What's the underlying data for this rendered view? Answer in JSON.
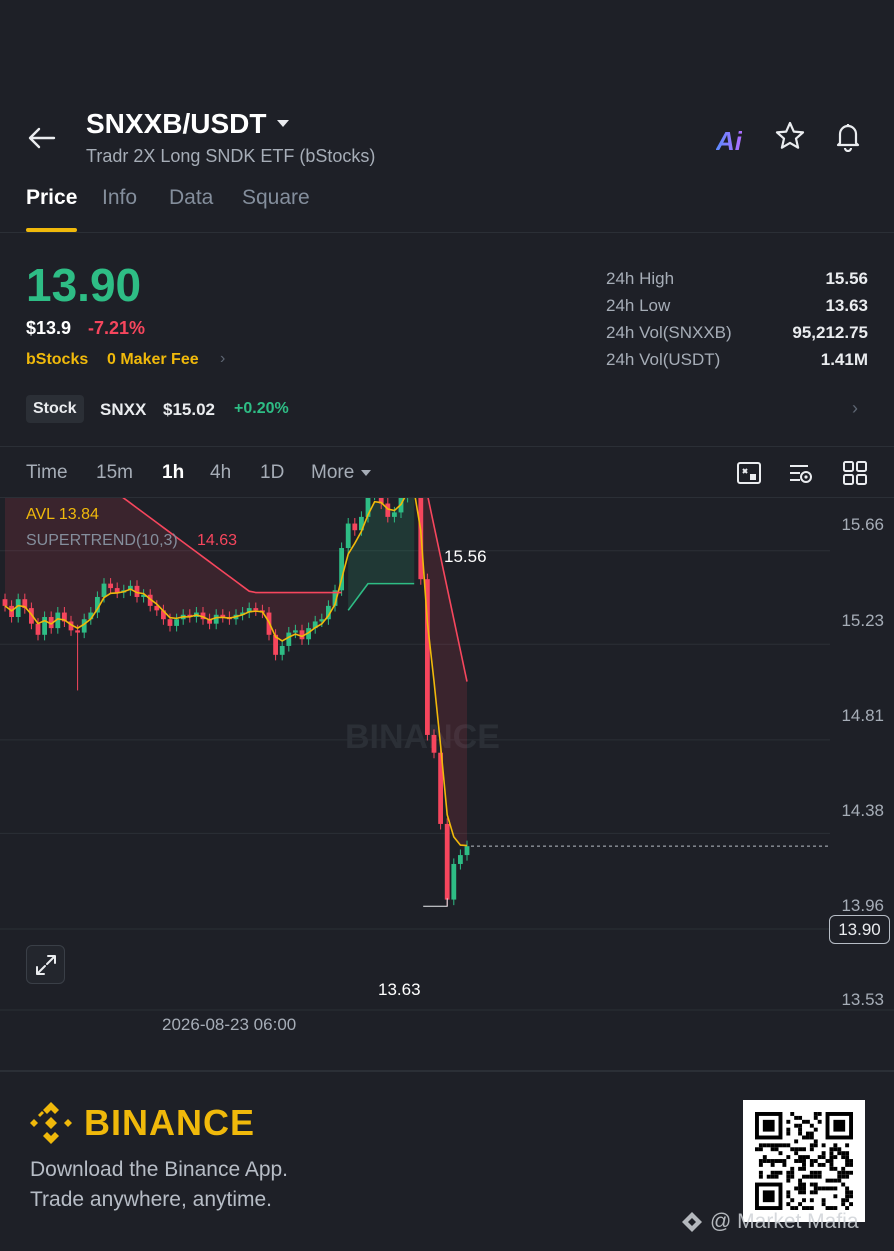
{
  "header": {
    "pair": "SNXXB/USDT",
    "subtitle": "Tradr 2X Long SNDK ETF (bStocks)",
    "ai_label": "Ai"
  },
  "tabs": [
    {
      "label": "Price",
      "active": true
    },
    {
      "label": "Info",
      "active": false
    },
    {
      "label": "Data",
      "active": false
    },
    {
      "label": "Square",
      "active": false
    }
  ],
  "price": {
    "last": "13.90",
    "usd": "$13.9",
    "change_pct": "-7.21%",
    "tag_exchange": "bStocks",
    "tag_fee": "0 Maker Fee"
  },
  "stats": [
    {
      "label": "24h High",
      "value": "15.56"
    },
    {
      "label": "24h Low",
      "value": "13.63"
    },
    {
      "label": "24h Vol(SNXXB)",
      "value": "95,212.75"
    },
    {
      "label": "24h Vol(USDT)",
      "value": "1.41M"
    }
  ],
  "stock": {
    "badge": "Stock",
    "symbol": "SNXX",
    "price": "$15.02",
    "change": "+0.20%"
  },
  "intervals": [
    {
      "label": "Time",
      "active": false
    },
    {
      "label": "15m",
      "active": false
    },
    {
      "label": "1h",
      "active": true
    },
    {
      "label": "4h",
      "active": false
    },
    {
      "label": "1D",
      "active": false
    },
    {
      "label": "More",
      "active": false
    }
  ],
  "indicators": {
    "avl": "AVL 13.84",
    "supertrend_label": "SUPERTREND(10,3)",
    "supertrend_value": "14.63"
  },
  "chart_data": {
    "type": "candlestick",
    "y_ticks": [
      "15.66",
      "15.23",
      "14.81",
      "14.38",
      "13.96",
      "13.53"
    ],
    "ylim": [
      13.4,
      15.75
    ],
    "current_price": "13.90",
    "high_marker": "15.56",
    "low_marker": "13.63",
    "x_label": "2026-08-23 06:00",
    "watermark": "BINANCE",
    "colors": {
      "up": "#2ebd85",
      "down": "#f6465d",
      "avl": "#f0b90b",
      "supertrend": "#f6465d"
    },
    "closes": [
      14.98,
      14.93,
      15.01,
      14.97,
      14.9,
      14.85,
      14.93,
      14.88,
      14.95,
      14.91,
      14.87,
      14.86,
      14.92,
      14.95,
      15.02,
      15.08,
      15.06,
      15.04,
      15.05,
      15.07,
      15.02,
      15.03,
      14.98,
      14.96,
      14.92,
      14.89,
      14.92,
      14.94,
      14.93,
      14.95,
      14.92,
      14.9,
      14.94,
      14.93,
      14.92,
      14.94,
      14.95,
      14.97,
      14.96,
      14.95,
      14.85,
      14.76,
      14.8,
      14.86,
      14.87,
      14.83,
      14.88,
      14.91,
      14.92,
      14.98,
      15.05,
      15.24,
      15.35,
      15.32,
      15.38,
      15.48,
      15.52,
      15.44,
      15.38,
      15.4,
      15.47,
      15.56,
      15.5,
      15.1,
      14.4,
      14.32,
      14.0,
      13.66,
      13.82,
      13.86,
      13.9
    ]
  },
  "footer": {
    "brand": "BINANCE",
    "line1": "Download the Binance App.",
    "line2": "Trade anywhere, anytime.",
    "watermark": "@ Market Mafia"
  }
}
